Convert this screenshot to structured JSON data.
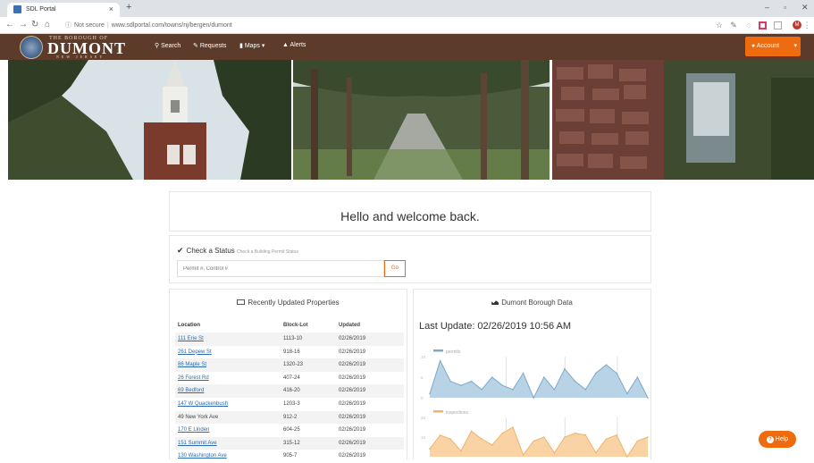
{
  "browser": {
    "tab_title": "SDL Portal",
    "tab_close": "×",
    "new_tab": "+",
    "security_label": "Not secure",
    "url": "www.sdlportal.com/towns/nj/bergen/dumont",
    "profile_initial": "M"
  },
  "site": {
    "logo_top": "THE BOROUGH OF",
    "logo_main": "DUMONT",
    "logo_sub": "NEW JERSEY",
    "nav": {
      "search": "Search",
      "requests": "Requests",
      "maps": "Maps",
      "alerts": "Alerts"
    },
    "account": "Account"
  },
  "welcome": "Hello and welcome back.",
  "status": {
    "title": "Check a Status",
    "subtitle": "Check a Building Permit Status",
    "placeholder": "Permit #, Control #",
    "go": "Go"
  },
  "properties": {
    "title": "Recently Updated Properties",
    "headers": [
      "Location",
      "Block-Lot",
      "Updated"
    ],
    "rows": [
      {
        "location": "111 Erie St",
        "blocklot": "1113-10",
        "updated": "02/26/2019",
        "link": true
      },
      {
        "location": "261 Depew St",
        "blocklot": "918-16",
        "updated": "02/26/2019",
        "link": true
      },
      {
        "location": "86 Maple St",
        "blocklot": "1320-23",
        "updated": "02/26/2019",
        "link": true
      },
      {
        "location": "26 Forest Rd",
        "blocklot": "407-24",
        "updated": "02/26/2019",
        "link": true
      },
      {
        "location": "69 Bedford",
        "blocklot": "416-20",
        "updated": "02/26/2019",
        "link": true
      },
      {
        "location": "147 W Quackenbush",
        "blocklot": "1203-3",
        "updated": "02/26/2019",
        "link": true
      },
      {
        "location": "49 New York Ave",
        "blocklot": "912-2",
        "updated": "02/26/2019",
        "link": false
      },
      {
        "location": "170 E Linden",
        "blocklot": "604-25",
        "updated": "02/26/2019",
        "link": true
      },
      {
        "location": "151 Summit Ave",
        "blocklot": "315-12",
        "updated": "02/26/2019",
        "link": true
      },
      {
        "location": "130 Washington Ave",
        "blocklot": "905-7",
        "updated": "02/26/2019",
        "link": true
      }
    ]
  },
  "borough": {
    "title": "Dumont Borough Data",
    "last_update": "Last Update: 02/26/2019 10:56 AM"
  },
  "chart_data": [
    {
      "type": "area",
      "series": [
        {
          "name": "permits",
          "values": [
            1,
            9,
            4,
            3,
            4,
            2,
            5,
            3,
            2,
            6,
            0,
            5,
            2,
            7,
            4,
            2,
            6,
            8,
            6,
            1,
            5,
            0
          ]
        }
      ],
      "yticks": [
        "0",
        "5",
        "10"
      ],
      "ylim": [
        0,
        10
      ],
      "color": "#b8d2e6"
    },
    {
      "type": "area",
      "series": [
        {
          "name": "inspections",
          "values": [
            4,
            11,
            9,
            3,
            13,
            9,
            6,
            12,
            15,
            1,
            8,
            10,
            2,
            10,
            12,
            11,
            2,
            9,
            11,
            0,
            8,
            10
          ]
        }
      ],
      "yticks": [
        "10",
        "20"
      ],
      "ylim": [
        0,
        20
      ],
      "color": "#f9d3a4"
    }
  ],
  "help": "Help"
}
